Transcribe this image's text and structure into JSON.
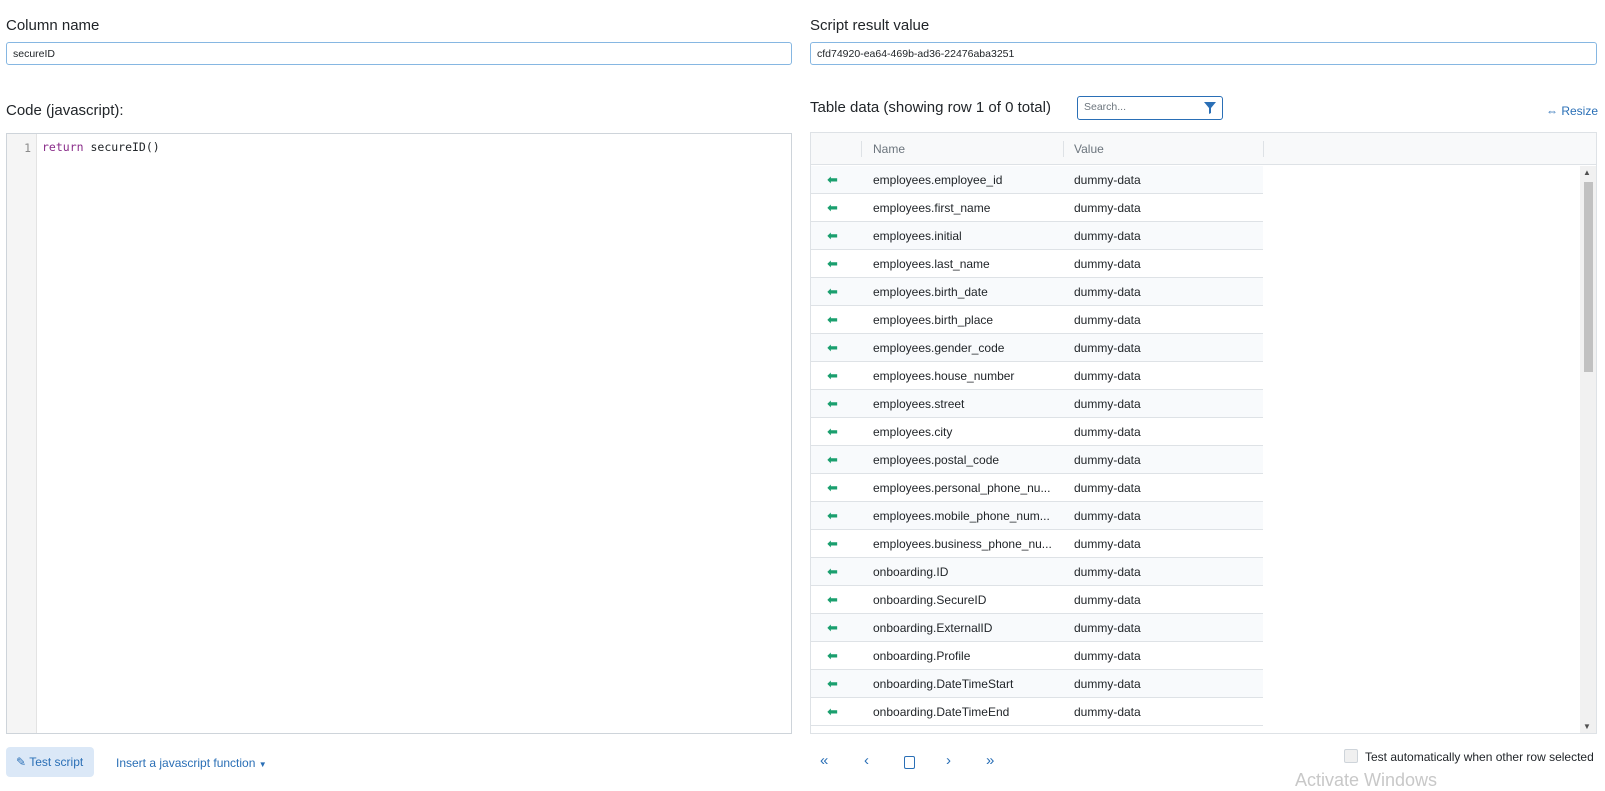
{
  "column_name": {
    "label": "Column name",
    "value": "secureID"
  },
  "script_result": {
    "label": "Script result value",
    "value": "cfd74920-ea64-469b-ad36-22476aba3251"
  },
  "code": {
    "label": "Code (javascript):",
    "line_number": "1",
    "keyword": "return",
    "rest": " secureID()"
  },
  "table": {
    "title": "Table data (showing row 1 of 0 total)",
    "search_placeholder": "Search...",
    "resize_label": "Resize",
    "headers": {
      "name": "Name",
      "value": "Value"
    },
    "rows": [
      {
        "name": "employees.employee_id",
        "value": "dummy-data"
      },
      {
        "name": "employees.first_name",
        "value": "dummy-data"
      },
      {
        "name": "employees.initial",
        "value": "dummy-data"
      },
      {
        "name": "employees.last_name",
        "value": "dummy-data"
      },
      {
        "name": "employees.birth_date",
        "value": "dummy-data"
      },
      {
        "name": "employees.birth_place",
        "value": "dummy-data"
      },
      {
        "name": "employees.gender_code",
        "value": "dummy-data"
      },
      {
        "name": "employees.house_number",
        "value": "dummy-data"
      },
      {
        "name": "employees.street",
        "value": "dummy-data"
      },
      {
        "name": "employees.city",
        "value": "dummy-data"
      },
      {
        "name": "employees.postal_code",
        "value": "dummy-data"
      },
      {
        "name": "employees.personal_phone_nu...",
        "value": "dummy-data"
      },
      {
        "name": "employees.mobile_phone_num...",
        "value": "dummy-data"
      },
      {
        "name": "employees.business_phone_nu...",
        "value": "dummy-data"
      },
      {
        "name": "onboarding.ID",
        "value": "dummy-data"
      },
      {
        "name": "onboarding.SecureID",
        "value": "dummy-data"
      },
      {
        "name": "onboarding.ExternalID",
        "value": "dummy-data"
      },
      {
        "name": "onboarding.Profile",
        "value": "dummy-data"
      },
      {
        "name": "onboarding.DateTimeStart",
        "value": "dummy-data"
      },
      {
        "name": "onboarding.DateTimeEnd",
        "value": "dummy-data"
      }
    ]
  },
  "actions": {
    "test_script": "Test script",
    "insert_function": "Insert a javascript function",
    "auto_test_label": "Test automatically when other row selected"
  },
  "pager": {
    "first": "«",
    "prev": "‹",
    "next": "›",
    "last": "»"
  },
  "watermark": "Activate Windows",
  "colors": {
    "accent": "#2a6fb6",
    "arrow": "#1a9f6e"
  }
}
